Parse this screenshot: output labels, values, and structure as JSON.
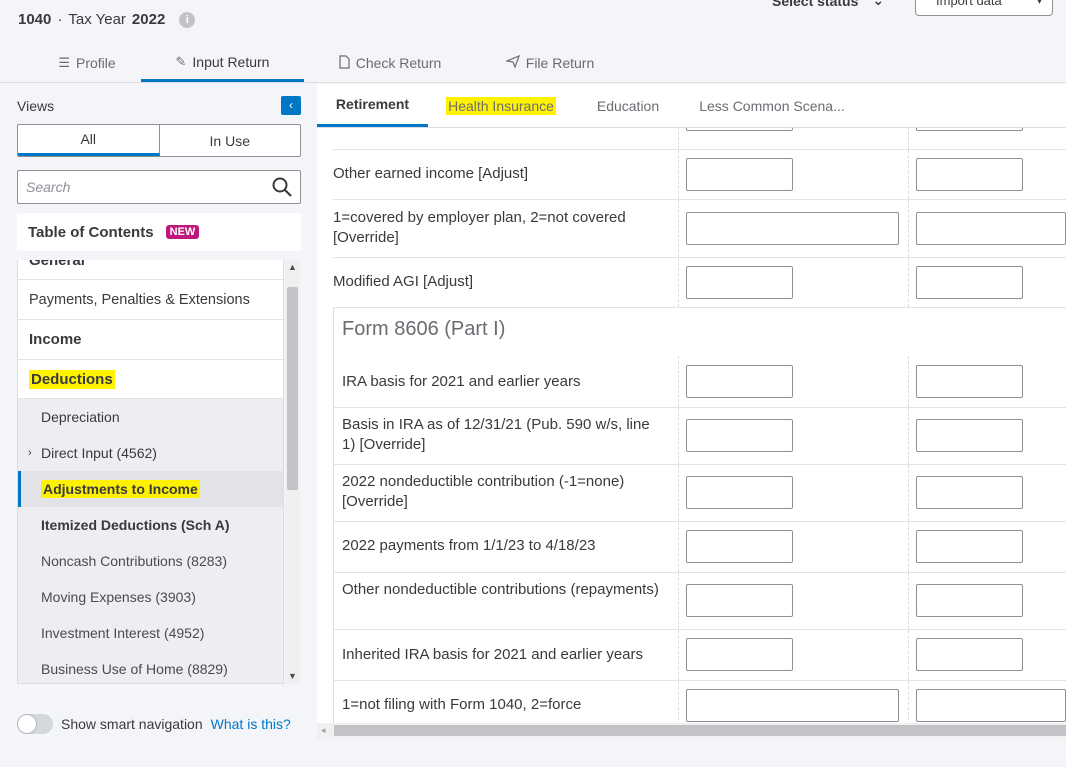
{
  "header": {
    "return_form": "1040",
    "separator": " · ",
    "tax_year_label": "Tax Year",
    "tax_year": "2022",
    "select_status": "Select status",
    "import_label": "Import data"
  },
  "main_tabs": [
    {
      "label": "Profile",
      "icon": "list-icon"
    },
    {
      "label": "Input Return",
      "icon": "pencil-icon"
    },
    {
      "label": "Check Return",
      "icon": "document-icon"
    },
    {
      "label": "File Return",
      "icon": "send-icon"
    }
  ],
  "sidebar": {
    "views_label": "Views",
    "toggle_all": "All",
    "toggle_in_use": "In Use",
    "search_placeholder": "Search",
    "toc_title": "Table of Contents",
    "new_badge": "NEW",
    "items": [
      {
        "label": "General"
      },
      {
        "label": "Payments, Penalties & Extensions"
      },
      {
        "label": "Income"
      },
      {
        "label": "Deductions"
      },
      {
        "label": "Depreciation"
      },
      {
        "label": "Direct Input (4562)"
      },
      {
        "label": "Adjustments to Income"
      },
      {
        "label": "Itemized Deductions (Sch A)"
      },
      {
        "label": "Noncash Contributions (8283)"
      },
      {
        "label": "Moving Expenses (3903)"
      },
      {
        "label": "Investment Interest (4952)"
      },
      {
        "label": "Business Use of Home (8829)"
      }
    ],
    "smart_nav_label": "Show smart navigation",
    "smart_nav_link": "What is this?"
  },
  "sub_tabs": [
    {
      "label": "Retirement"
    },
    {
      "label": "Health Insurance"
    },
    {
      "label": "Education"
    },
    {
      "label": "Less Common Scena..."
    }
  ],
  "form": {
    "rows_top": [
      {
        "label": "Other earned income [Adjust]"
      },
      {
        "label": "1=covered by employer plan, 2=not covered [Override]"
      },
      {
        "label": "Modified AGI [Adjust]"
      }
    ],
    "section_title": "Form 8606 (Part I)",
    "rows_section": [
      {
        "label": "IRA basis for 2021 and earlier years"
      },
      {
        "label": "Basis in IRA as of 12/31/21 (Pub. 590 w/s, line 1) [Override]"
      },
      {
        "label": "2022 nondeductible contribution (-1=none) [Override]"
      },
      {
        "label": "2022 payments from 1/1/23 to 4/18/23"
      },
      {
        "label": "Other nondeductible contributions (repayments)"
      },
      {
        "label": "Inherited IRA basis for 2021 and earlier years"
      },
      {
        "label": "1=not filing with Form 1040, 2=force"
      }
    ]
  },
  "colors": {
    "accent": "#0077c5",
    "highlight": "#fff200",
    "new_badge": "#c0187a"
  }
}
